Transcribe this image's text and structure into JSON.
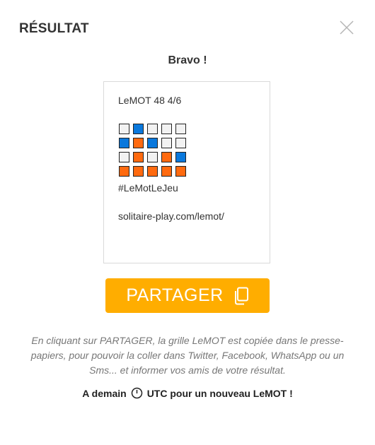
{
  "dialog": {
    "title": "RÉSULTAT",
    "close_icon": "close-icon"
  },
  "bravo": "Bravo !",
  "share_card": {
    "header": "LeMOT 48 4/6",
    "hashtag": "#LeMotLeJeu",
    "url": "solitaire-play.com/lemot/",
    "grid": [
      [
        "absent",
        "present",
        "absent",
        "absent",
        "absent"
      ],
      [
        "present",
        "correct",
        "present",
        "absent",
        "absent"
      ],
      [
        "absent",
        "correct",
        "absent",
        "correct",
        "present"
      ],
      [
        "correct",
        "correct",
        "correct",
        "correct",
        "correct"
      ]
    ],
    "colors": {
      "absent": "#f2f2f2",
      "present": "#0a78dc",
      "correct": "#ff6a0f"
    }
  },
  "share_button": {
    "label": "PARTAGER",
    "icon": "copy-icon",
    "color": "#ffad00"
  },
  "note": "En cliquant sur PARTAGER, la grille LeMOT est copiée dans le presse-papiers, pour pouvoir la coller dans Twitter, Facebook, WhatsApp ou un Sms... et informer vos amis de votre résultat.",
  "next_game": {
    "before": "A demain",
    "icon": "clock-icon",
    "after": "UTC pour un nouveau LeMOT !"
  }
}
